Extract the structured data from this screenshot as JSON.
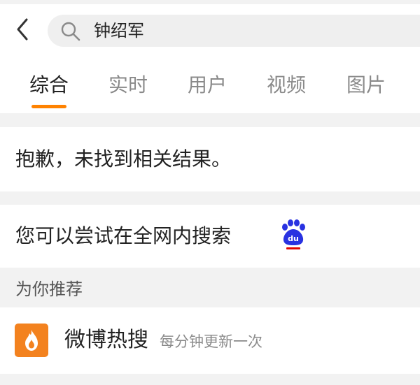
{
  "search": {
    "query": "钟绍军"
  },
  "tabs": [
    {
      "label": "综合",
      "active": true
    },
    {
      "label": "实时",
      "active": false
    },
    {
      "label": "用户",
      "active": false
    },
    {
      "label": "视频",
      "active": false
    },
    {
      "label": "图片",
      "active": false
    }
  ],
  "result": {
    "no_result_text": "抱歉，未找到相关结果。",
    "try_text": "您可以尝试在全网内搜索",
    "try_icon": "baidu-paw-icon",
    "try_icon_text": "du"
  },
  "recommend": {
    "header": "为你推荐",
    "items": [
      {
        "title": "微博热搜",
        "subtitle": "每分钟更新一次",
        "icon": "fire-icon"
      }
    ]
  },
  "colors": {
    "accent": "#ff8200",
    "hot_icon_bg": "#f3821f",
    "baidu_blue": "#2932e1",
    "baidu_red": "#e10601",
    "separator": "#f2f2f2",
    "search_bg": "#efefef"
  }
}
